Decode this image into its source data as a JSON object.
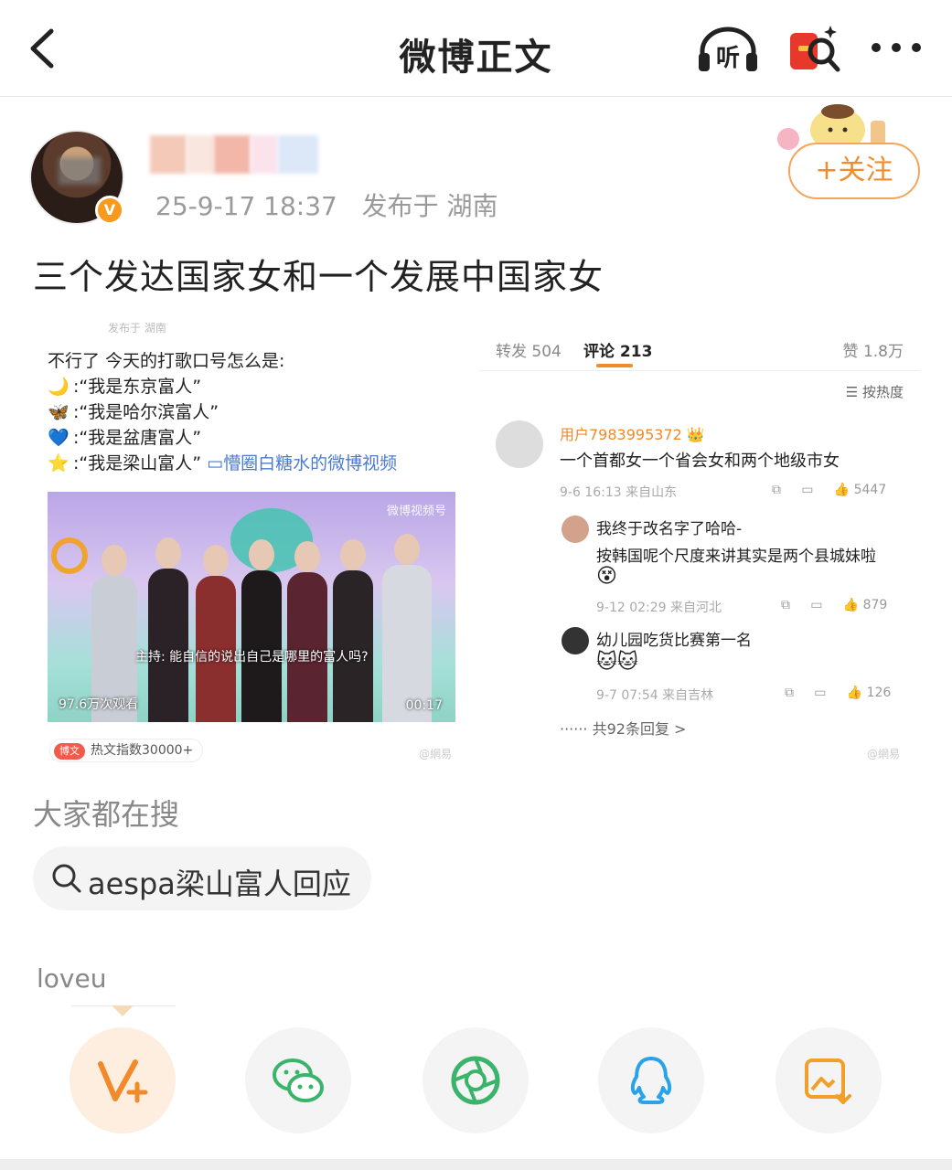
{
  "header": {
    "title": "微博正文",
    "listen_label": "听"
  },
  "author": {
    "verified_badge": "V",
    "timestamp": "25-9-17 18:37",
    "location_label": "发布于 湖南",
    "follow_label": "+关注"
  },
  "post": {
    "text": "三个发达国家女和一个发展中国家女"
  },
  "image": {
    "left": {
      "faded_top": "发布于 湖南",
      "heading": "不行了 今天的打歌口号怎么是:",
      "slogans": [
        {
          "icon": "🌙",
          "text": ":“我是东京富人”"
        },
        {
          "icon": "🦋",
          "text": ":“我是哈尔滨富人”"
        },
        {
          "icon": "💙",
          "text": ":“我是盆唐富人”"
        },
        {
          "icon": "⭐",
          "text": ":“我是梁山富人”",
          "link": "懵圈白糖水的微博视频"
        }
      ],
      "video": {
        "subtitle": "主持: 能自信的说出自己是哪里的富人吗?",
        "views": "97.6万次观看",
        "duration": "00:17",
        "watermark": "微博视频号"
      },
      "hot_tag": {
        "pill": "博文",
        "text": "热文指数30000+"
      },
      "corner_watermark": "@網易"
    },
    "right": {
      "tabs": {
        "repost": "转发 504",
        "comment": "评论 213",
        "like": "赞 1.8万"
      },
      "sort_label": "按热度",
      "comments": [
        {
          "user": "用户7983995372",
          "text": "一个首都女一个省会女和两个地级市女",
          "meta": "9-6 16:13 来自山东",
          "likes": "5447"
        },
        {
          "user": "我终于改名字了哈哈-",
          "text": "按韩国呢个尺度来讲其实是两个县城妹啦",
          "emoji": "😵",
          "meta": "9-12 02:29 来自河北",
          "likes": "879"
        },
        {
          "user": "幼儿园吃货比赛第一名",
          "emoji": "🐱🐱",
          "meta": "9-7 07:54 来自吉林",
          "likes": "126"
        }
      ],
      "more_replies": "共92条回复 >",
      "corner_watermark": "@網易"
    }
  },
  "search": {
    "title": "大家都在搜",
    "query": "aespa梁山富人回应"
  },
  "share": {
    "label": "loveu",
    "buttons": [
      "weibo-v-share",
      "wechat",
      "moments",
      "qq",
      "save-image"
    ]
  },
  "colors": {
    "accent": "#f08a2a",
    "link": "#4a7bd1",
    "wechat_green": "#3bb46b",
    "qq_blue": "#2aa2e8"
  }
}
